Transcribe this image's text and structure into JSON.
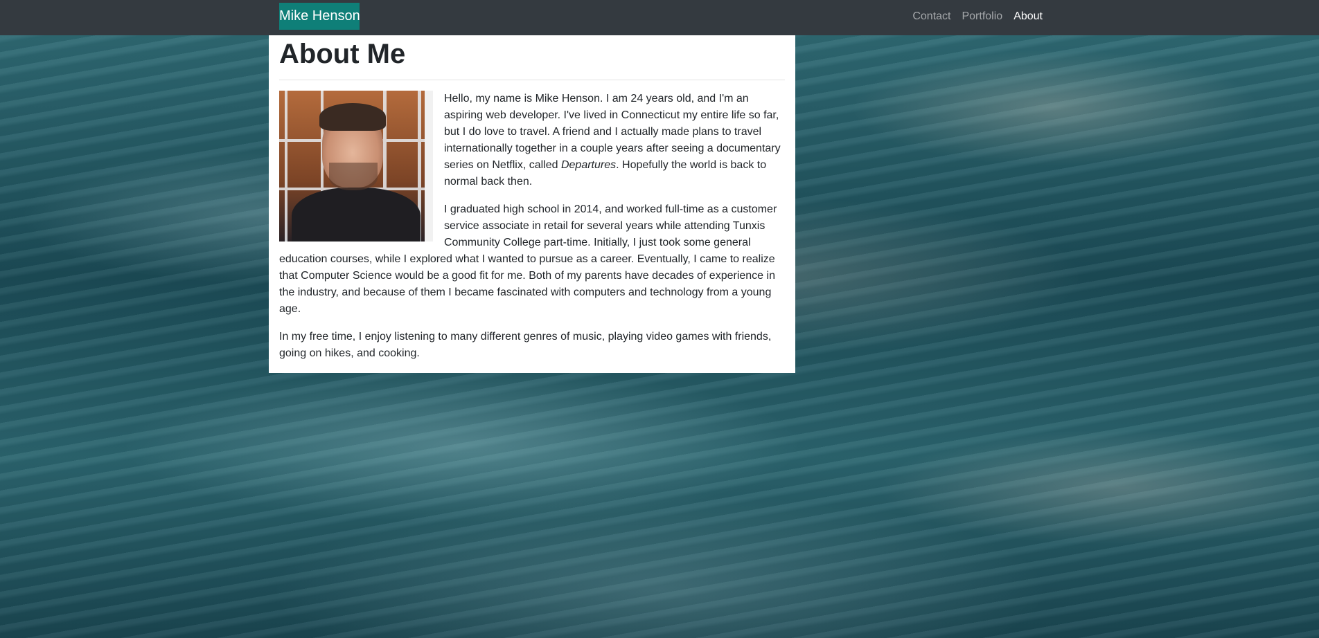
{
  "navbar": {
    "brand": "Mike Henson",
    "links": [
      {
        "label": "Contact",
        "active": false
      },
      {
        "label": "Portfolio",
        "active": false
      },
      {
        "label": "About",
        "active": true
      }
    ]
  },
  "page": {
    "title": "About Me",
    "photo_alt": "Portrait of Mike Henson",
    "paragraph1": {
      "before": "Hello, my name is Mike Henson. I am 24 years old, and I'm an aspiring web developer. I've lived in Connecticut my entire life so far, but I do love to travel. A friend and I actually made plans to travel internationally together in a couple years after seeing a documentary series on Netflix, called ",
      "emphasis": "Departures",
      "after": ". Hopefully the world is back to normal back then."
    },
    "paragraph2": "I graduated high school in 2014, and worked full-time as a customer service associate in retail for several years while attending Tunxis Community College part-time. Initially, I just took some general education courses, while I explored what I wanted to pursue as a career. Eventually, I came to realize that Computer Science would be a good fit for me. Both of my parents have decades of experience in the industry, and because of them I became fascinated with computers and technology from a young age.",
    "paragraph3": "In my free time, I enjoy listening to many different genres of music, playing video games with friends, going on hikes, and cooking."
  },
  "colors": {
    "navbar_bg": "#343a40",
    "brand_bg": "#0f7f78",
    "card_bg": "#ffffff",
    "text": "#212529"
  }
}
